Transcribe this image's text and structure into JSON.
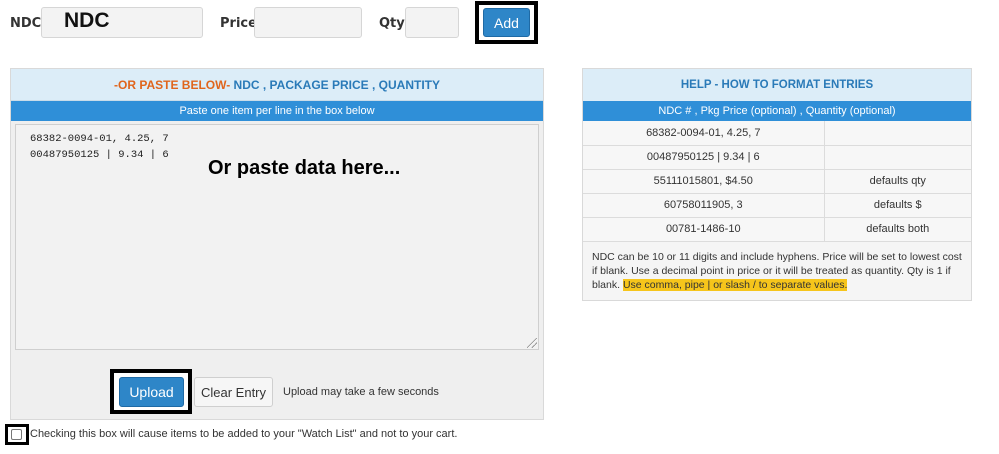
{
  "entry": {
    "ndc_label": "NDC",
    "ndc_value": "NDC",
    "price_label": "Price",
    "price_value": "",
    "qty_label": "Qty",
    "qty_value": "",
    "add_button": "Add"
  },
  "paste_panel": {
    "title_prefix": "-OR PASTE BELOW-",
    "title_rest": " NDC , PACKAGE PRICE , QUANTITY",
    "subtitle": "Paste one item per line in the box below",
    "lines": [
      "68382-0094-01, 4.25, 7",
      "00487950125 | 9.34 | 6"
    ],
    "overlay": "Or paste data here...",
    "upload_button": "Upload",
    "clear_button": "Clear Entry",
    "upload_note": "Upload may take a few seconds"
  },
  "help": {
    "title": "HELP - HOW TO FORMAT ENTRIES",
    "subtitle": "NDC # , Pkg Price (optional) , Quantity (optional)",
    "rows": [
      {
        "example": "68382-0094-01, 4.25, 7",
        "note": ""
      },
      {
        "example": "00487950125 | 9.34 | 6",
        "note": ""
      },
      {
        "example": "55111015801, $4.50",
        "note": "defaults qty"
      },
      {
        "example": "60758011905, 3",
        "note": "defaults $"
      },
      {
        "example": "00781-1486-10",
        "note": "defaults both"
      }
    ],
    "text": "NDC can be 10 or 11 digits and include hyphens. Price will be set to lowest cost if blank. Use a decimal point in price or it will be treated as quantity. Qty is 1 if blank. ",
    "highlight": "Use comma, pipe | or slash / to separate values."
  },
  "watch_list": {
    "label": "Checking this box will cause items to be added to your \"Watch List\" and not to your cart."
  },
  "colors": {
    "accent_blue": "#2f8fd8",
    "button_blue": "#2e86c8",
    "header_orange": "#e0651c",
    "highlight_yellow": "#f6c51b"
  }
}
